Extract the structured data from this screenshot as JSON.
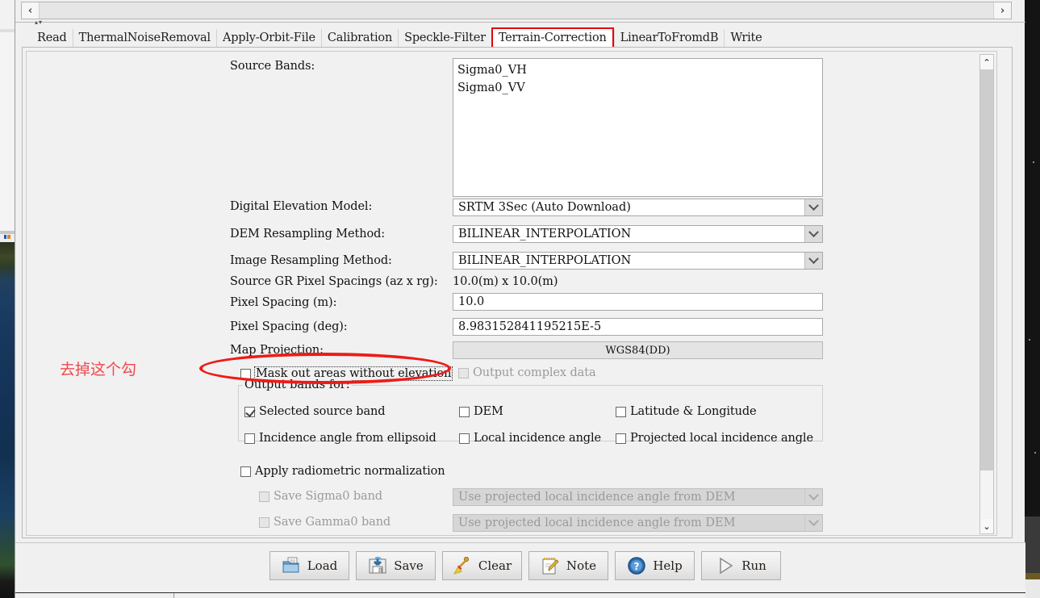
{
  "window": {
    "title": "SNAP Graph Builder - Terrain Correction tab"
  },
  "scrollbars": {
    "h_left_arrow": "‹",
    "h_right_arrow": "›",
    "v_up_arrow": "⌃",
    "v_down_arrow": "⌄",
    "splitter_glyphs": "▴▾"
  },
  "tabs": [
    {
      "label": "Read",
      "selected": false
    },
    {
      "label": "ThermalNoiseRemoval",
      "selected": false
    },
    {
      "label": "Apply-Orbit-File",
      "selected": false
    },
    {
      "label": "Calibration",
      "selected": false
    },
    {
      "label": "Speckle-Filter",
      "selected": false
    },
    {
      "label": "Terrain-Correction",
      "selected": true
    },
    {
      "label": "LinearToFromdB",
      "selected": false
    },
    {
      "label": "Write",
      "selected": false
    }
  ],
  "form": {
    "source_bands_label": "Source Bands:",
    "source_bands": [
      "Sigma0_VH",
      "Sigma0_VV"
    ],
    "dem_label": "Digital Elevation Model:",
    "dem_value": "SRTM 3Sec (Auto Download)",
    "dem_resampling_label": "DEM Resampling Method:",
    "dem_resampling_value": "BILINEAR_INTERPOLATION",
    "image_resampling_label": "Image Resampling Method:",
    "image_resampling_value": "BILINEAR_INTERPOLATION",
    "source_gr_label": "Source GR Pixel Spacings (az x rg):",
    "source_gr_value": "10.0(m) x 10.0(m)",
    "pixel_spacing_m_label": "Pixel Spacing (m):",
    "pixel_spacing_m_value": "10.0",
    "pixel_spacing_deg_label": "Pixel Spacing (deg):",
    "pixel_spacing_deg_value": "8.983152841195215E-5",
    "map_projection_label": "Map Projection:",
    "map_projection_value": "WGS84(DD)",
    "mask_out_label": "Mask out areas without elevation",
    "mask_out_checked": false,
    "output_complex_label": "Output complex data",
    "output_complex_checked": false,
    "output_complex_enabled": false,
    "output_bands_group_title": "Output bands for:",
    "output_bands": [
      {
        "label": "Selected source band",
        "checked": true
      },
      {
        "label": "DEM",
        "checked": false
      },
      {
        "label": "Latitude & Longitude",
        "checked": false
      },
      {
        "label": "Incidence angle from ellipsoid",
        "checked": false
      },
      {
        "label": "Local incidence angle",
        "checked": false
      },
      {
        "label": "Projected local incidence angle",
        "checked": false
      }
    ],
    "apply_radiometric_label": "Apply radiometric normalization",
    "apply_radiometric_checked": false,
    "save_sigma0_label": "Save Sigma0 band",
    "save_sigma0_checked": false,
    "save_sigma0_combo": "Use projected local incidence angle from DEM",
    "save_gamma0_label": "Save Gamma0 band",
    "save_gamma0_checked": false,
    "save_gamma0_combo": "Use projected local incidence angle from DEM"
  },
  "annotation": {
    "text": "去掉这个勾",
    "color": "#ee1b17"
  },
  "buttons": [
    {
      "label": "Load",
      "icon": "folder-open-icon"
    },
    {
      "label": "Save",
      "icon": "floppy-disk-icon"
    },
    {
      "label": "Clear",
      "icon": "broom-icon"
    },
    {
      "label": "Note",
      "icon": "notepad-pencil-icon"
    },
    {
      "label": "Help",
      "icon": "question-circle-icon"
    },
    {
      "label": "Run",
      "icon": "play-triangle-icon"
    }
  ],
  "colors": {
    "accent_red": "#ee1b17",
    "annotation_red": "#f0494e",
    "panel_bg": "#f1f1f1",
    "field_bg": "#ffffff",
    "disabled_text": "#9a9a9a"
  }
}
